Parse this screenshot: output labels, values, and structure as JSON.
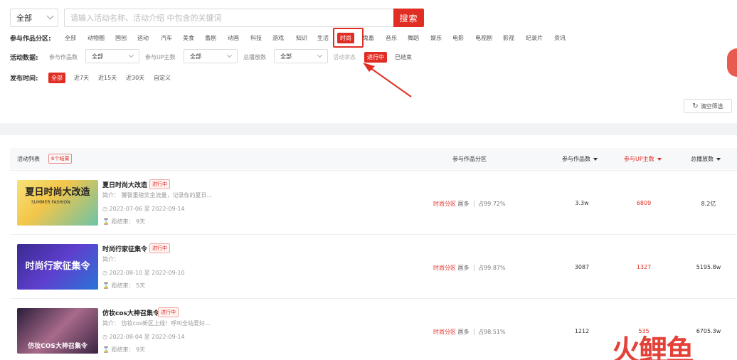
{
  "search": {
    "scope_value": "全部",
    "placeholder": "请输入活动名称、活动介绍 中包含的关键词",
    "button_label": "搜索"
  },
  "category_filter": {
    "label": "参与作品分区:",
    "items": [
      "全部",
      "动物圈",
      "国创",
      "运动",
      "汽车",
      "美食",
      "番剧",
      "动画",
      "科技",
      "游戏",
      "知识",
      "生活",
      "时尚",
      "鬼畜",
      "音乐",
      "舞蹈",
      "娱乐",
      "电影",
      "电视剧",
      "影视",
      "纪录片",
      "资讯"
    ],
    "active": "时尚"
  },
  "activity_filter": {
    "label": "活动数据:",
    "works_label": "参与作品数",
    "works_value": "全部",
    "up_label": "参与UP主数",
    "up_value": "全部",
    "plays_label": "总播放数",
    "plays_value": "全部",
    "status_label": "活动状态",
    "status_options": [
      "进行中",
      "已结束"
    ],
    "status_active": "进行中"
  },
  "time_filter": {
    "label": "发布时间:",
    "options": [
      "全部",
      "近7天",
      "近15天",
      "近30天",
      "自定义"
    ],
    "active": "全部"
  },
  "clear_button": "清空筛选",
  "table": {
    "list_label": "活动列表",
    "result_count": "6个结果",
    "col_category": "参与作品分区",
    "col_works": "参与作品数",
    "col_up": "参与UP主数",
    "col_plays": "总播放数",
    "rows": [
      {
        "title": "夏日时尚大改造",
        "status": "进行中",
        "intro": "简介：  饕餮重磅奖金流量，记录你的夏日...",
        "dates": "2022-07-06 至 2022-09-14",
        "remaining": "距结束：  9天",
        "thumb_text": "夏日时尚大改造",
        "thumb_sub": "SUMMER FASHION",
        "category": "时尚分区",
        "category_rank": "居多",
        "share": "占99.72%",
        "works": "3.3w",
        "ups": "6809",
        "plays": "8.2亿"
      },
      {
        "title": "时尚行家征集令",
        "status": "进行中",
        "intro": "简介：",
        "dates": "2022-08-10 至 2022-09-10",
        "remaining": "距结束：  5天",
        "thumb_text": "时尚行家征集令",
        "category": "时尚分区",
        "category_rank": "居多",
        "share": "占99.87%",
        "works": "3087",
        "ups": "1327",
        "plays": "5195.8w"
      },
      {
        "title": "仿妆cos大神召集令",
        "status": "进行中",
        "intro": "简介：  仿妆cos新区上线！呼叫全站爱好...",
        "dates": "2022-08-04 至 2022-09-14",
        "remaining": "距结束：  9天",
        "thumb_text": "仿妆COS大神召集令",
        "category": "时尚分区",
        "category_rank": "居多",
        "share": "占98.51%",
        "works": "1212",
        "ups": "535",
        "plays": "6705.3w"
      }
    ]
  },
  "watermark": "火鲤鱼",
  "colors": {
    "accent": "#e02e24",
    "tag_bg": "#fff2f1"
  }
}
